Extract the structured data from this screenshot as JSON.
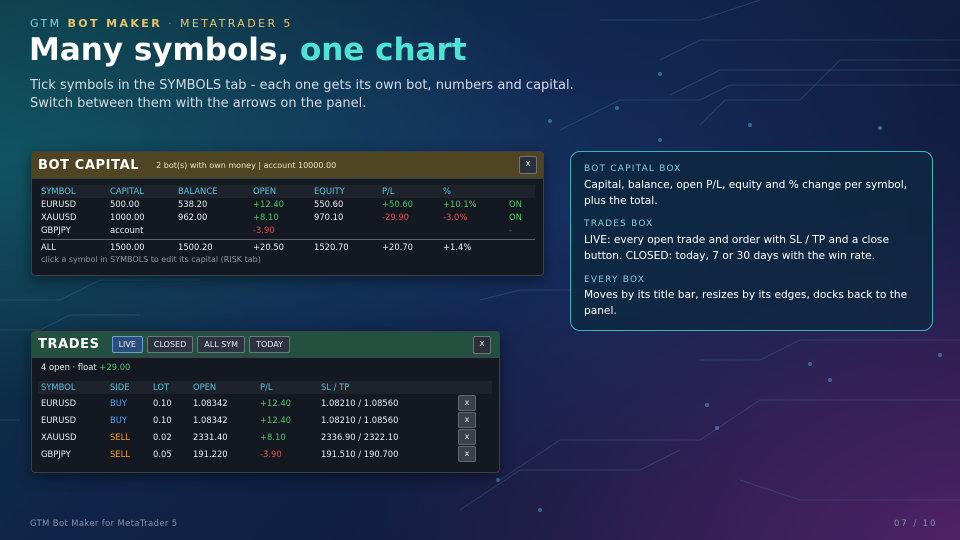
{
  "header": {
    "brand_name": "GTM",
    "brand_product": "BOT MAKER",
    "separator": "·",
    "platform": "METATRADER 5",
    "title_main": "Many symbols,",
    "title_accent": "one chart",
    "subtitle_line1": "Tick symbols in the SYMBOLS tab - each one gets its own bot, numbers and capital.",
    "subtitle_line2": "Switch between them with the arrows on the panel."
  },
  "bot_capital": {
    "title": "BOT CAPITAL",
    "info": "2 bot(s) with own money | account 10000.00",
    "close_label": "x",
    "columns": [
      "SYMBOL",
      "CAPITAL",
      "BALANCE",
      "OPEN",
      "EQUITY",
      "P/L",
      "%"
    ],
    "rows": [
      {
        "symbol": "EURUSD",
        "capital": "500.00",
        "balance": "538.20",
        "open": "+12.40",
        "equity": "550.60",
        "pl": "+50.60",
        "pct": "+10.1%",
        "status": "ON"
      },
      {
        "symbol": "XAUUSD",
        "capital": "1000.00",
        "balance": "962.00",
        "open": "+8.10",
        "equity": "970.10",
        "pl": "-29.90",
        "pct": "-3.0%",
        "status": "ON"
      },
      {
        "symbol": "GBPJPY",
        "capital": "account",
        "balance": "",
        "open": "-3.90",
        "equity": "",
        "pl": "",
        "pct": "",
        "status": "-"
      }
    ],
    "total": {
      "symbol": "ALL",
      "capital": "1500.00",
      "balance": "1500.20",
      "open": "+20.50",
      "equity": "1520.70",
      "pl": "+20.70",
      "pct": "+1.4%"
    },
    "hint": "click a symbol in SYMBOLS to edit its capital (RISK tab)"
  },
  "trades": {
    "title": "TRADES",
    "tabs": [
      "LIVE",
      "CLOSED",
      "ALL SYM",
      "TODAY"
    ],
    "active_tab": "LIVE",
    "close_label": "x",
    "summary_prefix": "4 open · float",
    "summary_value": "+29.00",
    "columns": [
      "SYMBOL",
      "SIDE",
      "LOT",
      "OPEN",
      "P/L",
      "SL / TP"
    ],
    "rows": [
      {
        "symbol": "EURUSD",
        "side": "BUY",
        "lot": "0.10",
        "open": "1.08342",
        "pl": "+12.40",
        "sltp": "1.08210 / 1.08560"
      },
      {
        "symbol": "EURUSD",
        "side": "BUY",
        "lot": "0.10",
        "open": "1.08342",
        "pl": "+12.40",
        "sltp": "1.08210 / 1.08560"
      },
      {
        "symbol": "XAUUSD",
        "side": "SELL",
        "lot": "0.02",
        "open": "2331.40",
        "pl": "+8.10",
        "sltp": "2336.90 / 2322.10"
      },
      {
        "symbol": "GBPJPY",
        "side": "SELL",
        "lot": "0.05",
        "open": "191.220",
        "pl": "-3.90",
        "sltp": "191.510 / 190.700"
      }
    ],
    "row_close_label": "x"
  },
  "info_card": {
    "sections": [
      {
        "title": "BOT CAPITAL BOX",
        "line1": "Capital, balance, open P/L, equity and % change per symbol,",
        "line2": "plus the total."
      },
      {
        "title": "TRADES BOX",
        "line1": "LIVE: every open trade and order with SL / TP and a close",
        "line2": "button. CLOSED: today, 7 or 30 days with the win rate."
      },
      {
        "title": "EVERY BOX",
        "line1": "Moves by its title bar, resizes by its edges, docks back to the",
        "line2": "panel."
      }
    ]
  },
  "footer": {
    "left": "GTM Bot Maker for MetaTrader 5",
    "page": "07 / 10"
  },
  "colors": {
    "accent": "#4fe3d6",
    "brand_gold": "#e9c46a",
    "profit": "#4cc46a",
    "loss": "#e5484d",
    "buy": "#4aa3f0",
    "sell": "#f0a028",
    "capital_header": "#4f4522",
    "trades_header": "#24503f"
  }
}
